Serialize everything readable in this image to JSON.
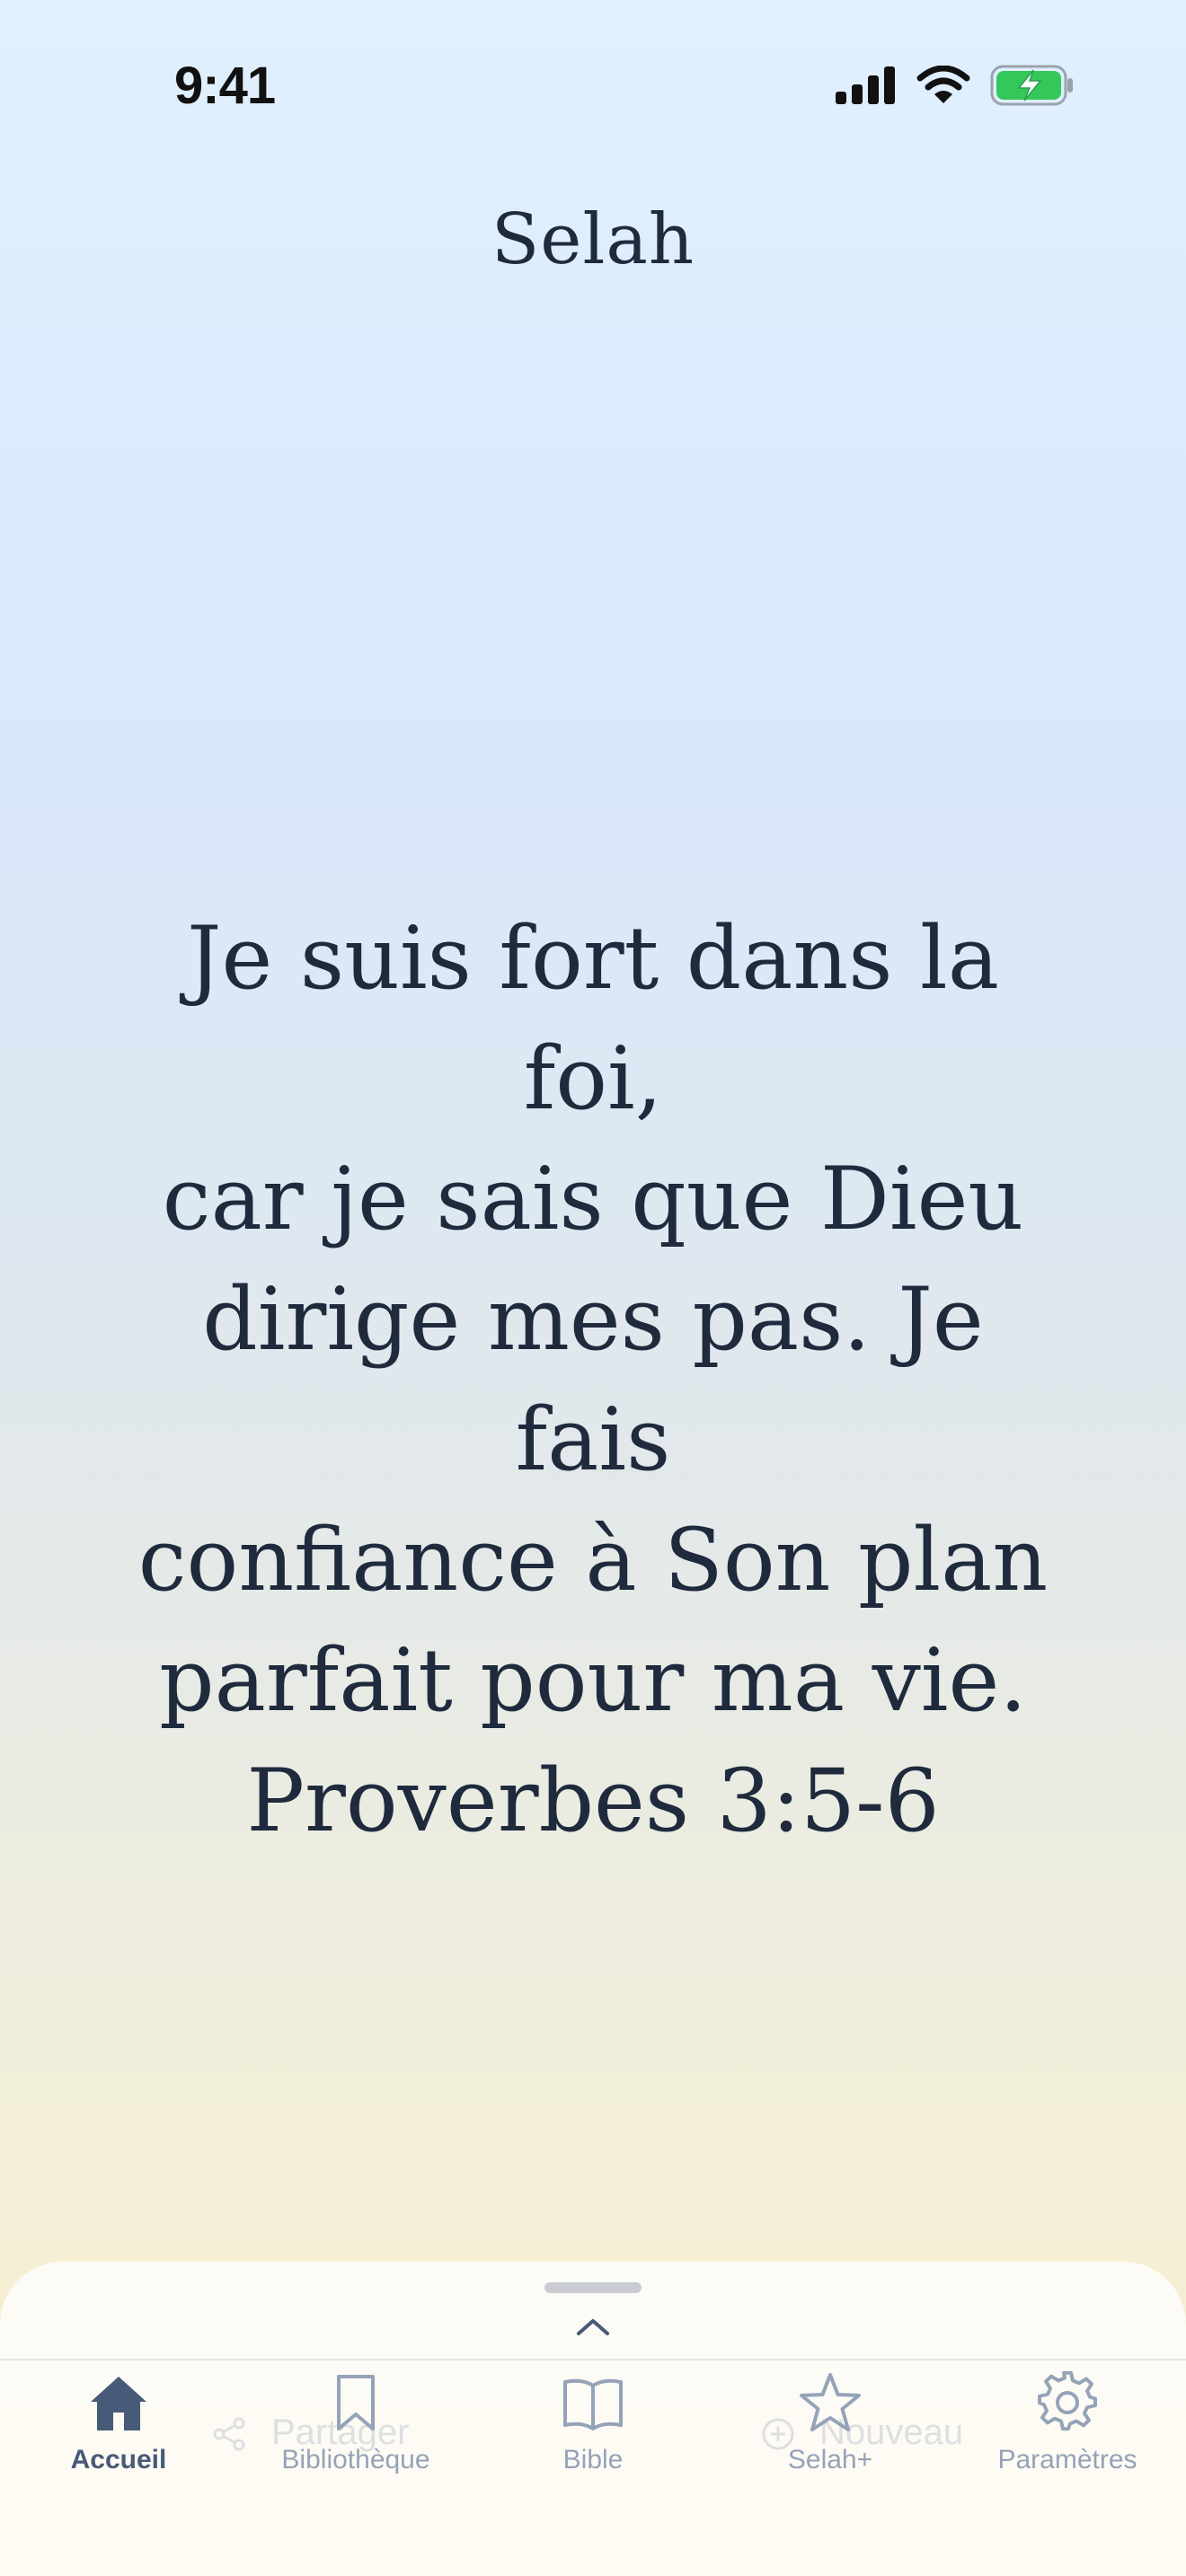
{
  "status_bar": {
    "time": "9:41",
    "icons": [
      "signal-icon",
      "wifi-icon",
      "battery-charging-icon"
    ]
  },
  "header": {
    "title": "Selah"
  },
  "affirmation": {
    "lines": [
      "Je suis fort dans la foi,",
      "car je sais que Dieu",
      "dirige mes pas. Je fais",
      "confiance à Son plan",
      "parfait pour ma vie."
    ],
    "reference": "Proverbes 3:5-6"
  },
  "hidden_actions": {
    "share": "Partager",
    "new": "Nouveau"
  },
  "tabbar": {
    "items": [
      {
        "label": "Accueil",
        "icon": "home-icon",
        "active": true
      },
      {
        "label": "Bibliothèque",
        "icon": "bookmark-icon",
        "active": false
      },
      {
        "label": "Bible",
        "icon": "book-icon",
        "active": false
      },
      {
        "label": "Selah+",
        "icon": "star-icon",
        "active": false
      },
      {
        "label": "Paramètres",
        "icon": "gear-icon",
        "active": false
      }
    ]
  },
  "colors": {
    "text": "#1f2a3d",
    "tab_active": "#475a78",
    "tab_inactive": "#94a3b8"
  }
}
